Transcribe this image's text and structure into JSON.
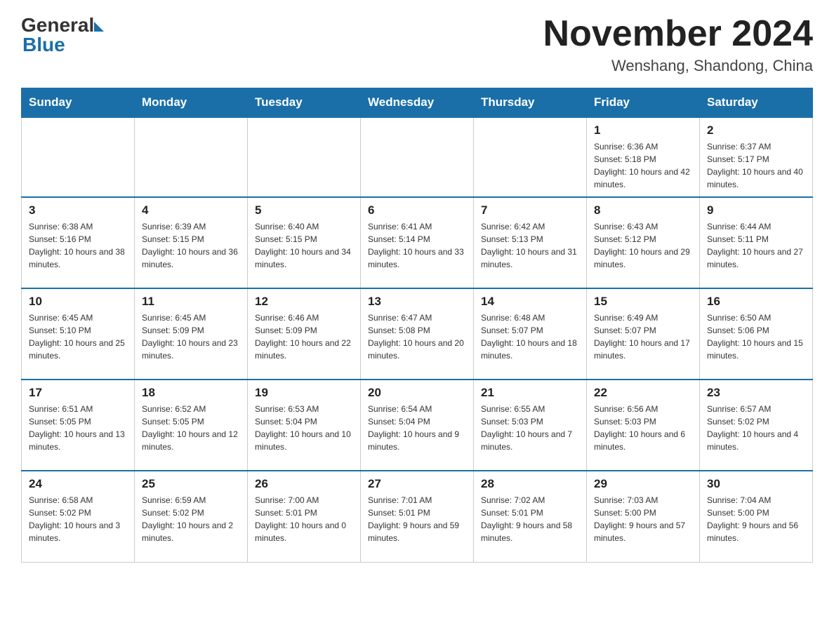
{
  "header": {
    "logo_general": "General",
    "logo_blue": "Blue",
    "month_title": "November 2024",
    "location": "Wenshang, Shandong, China"
  },
  "days_of_week": [
    "Sunday",
    "Monday",
    "Tuesday",
    "Wednesday",
    "Thursday",
    "Friday",
    "Saturday"
  ],
  "weeks": [
    [
      {
        "day": "",
        "info": ""
      },
      {
        "day": "",
        "info": ""
      },
      {
        "day": "",
        "info": ""
      },
      {
        "day": "",
        "info": ""
      },
      {
        "day": "",
        "info": ""
      },
      {
        "day": "1",
        "info": "Sunrise: 6:36 AM\nSunset: 5:18 PM\nDaylight: 10 hours and 42 minutes."
      },
      {
        "day": "2",
        "info": "Sunrise: 6:37 AM\nSunset: 5:17 PM\nDaylight: 10 hours and 40 minutes."
      }
    ],
    [
      {
        "day": "3",
        "info": "Sunrise: 6:38 AM\nSunset: 5:16 PM\nDaylight: 10 hours and 38 minutes."
      },
      {
        "day": "4",
        "info": "Sunrise: 6:39 AM\nSunset: 5:15 PM\nDaylight: 10 hours and 36 minutes."
      },
      {
        "day": "5",
        "info": "Sunrise: 6:40 AM\nSunset: 5:15 PM\nDaylight: 10 hours and 34 minutes."
      },
      {
        "day": "6",
        "info": "Sunrise: 6:41 AM\nSunset: 5:14 PM\nDaylight: 10 hours and 33 minutes."
      },
      {
        "day": "7",
        "info": "Sunrise: 6:42 AM\nSunset: 5:13 PM\nDaylight: 10 hours and 31 minutes."
      },
      {
        "day": "8",
        "info": "Sunrise: 6:43 AM\nSunset: 5:12 PM\nDaylight: 10 hours and 29 minutes."
      },
      {
        "day": "9",
        "info": "Sunrise: 6:44 AM\nSunset: 5:11 PM\nDaylight: 10 hours and 27 minutes."
      }
    ],
    [
      {
        "day": "10",
        "info": "Sunrise: 6:45 AM\nSunset: 5:10 PM\nDaylight: 10 hours and 25 minutes."
      },
      {
        "day": "11",
        "info": "Sunrise: 6:45 AM\nSunset: 5:09 PM\nDaylight: 10 hours and 23 minutes."
      },
      {
        "day": "12",
        "info": "Sunrise: 6:46 AM\nSunset: 5:09 PM\nDaylight: 10 hours and 22 minutes."
      },
      {
        "day": "13",
        "info": "Sunrise: 6:47 AM\nSunset: 5:08 PM\nDaylight: 10 hours and 20 minutes."
      },
      {
        "day": "14",
        "info": "Sunrise: 6:48 AM\nSunset: 5:07 PM\nDaylight: 10 hours and 18 minutes."
      },
      {
        "day": "15",
        "info": "Sunrise: 6:49 AM\nSunset: 5:07 PM\nDaylight: 10 hours and 17 minutes."
      },
      {
        "day": "16",
        "info": "Sunrise: 6:50 AM\nSunset: 5:06 PM\nDaylight: 10 hours and 15 minutes."
      }
    ],
    [
      {
        "day": "17",
        "info": "Sunrise: 6:51 AM\nSunset: 5:05 PM\nDaylight: 10 hours and 13 minutes."
      },
      {
        "day": "18",
        "info": "Sunrise: 6:52 AM\nSunset: 5:05 PM\nDaylight: 10 hours and 12 minutes."
      },
      {
        "day": "19",
        "info": "Sunrise: 6:53 AM\nSunset: 5:04 PM\nDaylight: 10 hours and 10 minutes."
      },
      {
        "day": "20",
        "info": "Sunrise: 6:54 AM\nSunset: 5:04 PM\nDaylight: 10 hours and 9 minutes."
      },
      {
        "day": "21",
        "info": "Sunrise: 6:55 AM\nSunset: 5:03 PM\nDaylight: 10 hours and 7 minutes."
      },
      {
        "day": "22",
        "info": "Sunrise: 6:56 AM\nSunset: 5:03 PM\nDaylight: 10 hours and 6 minutes."
      },
      {
        "day": "23",
        "info": "Sunrise: 6:57 AM\nSunset: 5:02 PM\nDaylight: 10 hours and 4 minutes."
      }
    ],
    [
      {
        "day": "24",
        "info": "Sunrise: 6:58 AM\nSunset: 5:02 PM\nDaylight: 10 hours and 3 minutes."
      },
      {
        "day": "25",
        "info": "Sunrise: 6:59 AM\nSunset: 5:02 PM\nDaylight: 10 hours and 2 minutes."
      },
      {
        "day": "26",
        "info": "Sunrise: 7:00 AM\nSunset: 5:01 PM\nDaylight: 10 hours and 0 minutes."
      },
      {
        "day": "27",
        "info": "Sunrise: 7:01 AM\nSunset: 5:01 PM\nDaylight: 9 hours and 59 minutes."
      },
      {
        "day": "28",
        "info": "Sunrise: 7:02 AM\nSunset: 5:01 PM\nDaylight: 9 hours and 58 minutes."
      },
      {
        "day": "29",
        "info": "Sunrise: 7:03 AM\nSunset: 5:00 PM\nDaylight: 9 hours and 57 minutes."
      },
      {
        "day": "30",
        "info": "Sunrise: 7:04 AM\nSunset: 5:00 PM\nDaylight: 9 hours and 56 minutes."
      }
    ]
  ]
}
